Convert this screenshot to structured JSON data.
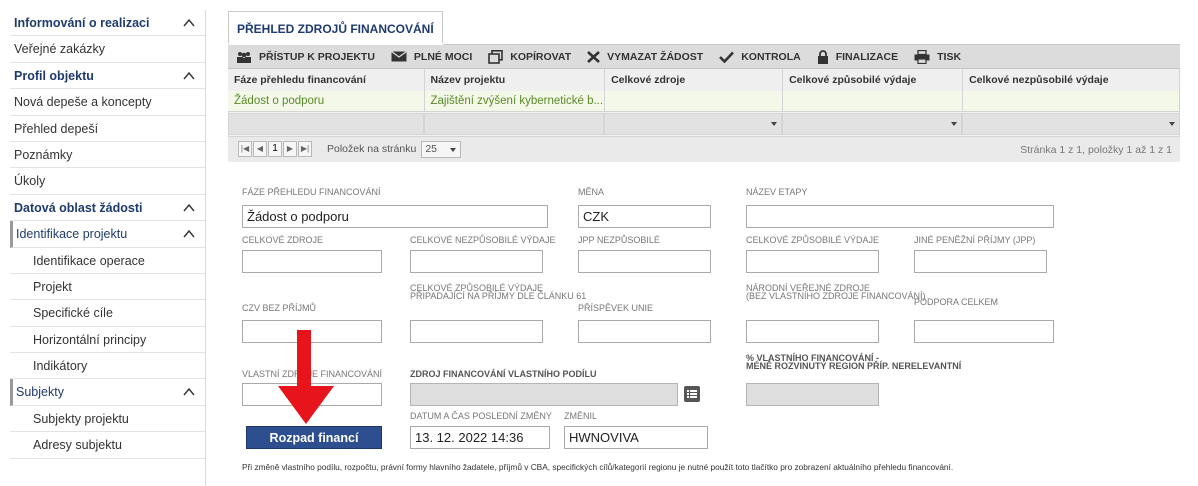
{
  "sidebar": {
    "items": [
      {
        "label": "Informování o realizaci",
        "type": "head"
      },
      {
        "label": "Veřejné zakázky",
        "type": "item"
      },
      {
        "label": "Profil objektu",
        "type": "head"
      },
      {
        "label": "Nová depeše a koncepty",
        "type": "item"
      },
      {
        "label": "Přehled depeší",
        "type": "item"
      },
      {
        "label": "Poznámky",
        "type": "item"
      },
      {
        "label": "Úkoly",
        "type": "item"
      },
      {
        "label": "Datová oblast žádosti",
        "type": "head"
      },
      {
        "label": "Identifikace projektu",
        "type": "group"
      },
      {
        "label": "Identifikace operace",
        "type": "sub"
      },
      {
        "label": "Projekt",
        "type": "sub"
      },
      {
        "label": "Specifické cíle",
        "type": "sub"
      },
      {
        "label": "Horizontální principy",
        "type": "sub"
      },
      {
        "label": "Indikátory",
        "type": "sub"
      },
      {
        "label": "Subjekty",
        "type": "group"
      },
      {
        "label": "Subjekty projektu",
        "type": "sub"
      },
      {
        "label": "Adresy subjektu",
        "type": "sub"
      }
    ]
  },
  "tab": {
    "label": "PŘEHLED ZDROJŮ FINANCOVÁNÍ"
  },
  "toolbar": {
    "access": "PŘÍSTUP K PROJEKTU",
    "powers": "PLNÉ MOCI",
    "copy": "KOPÍROVAT",
    "delete": "VYMAZAT ŽÁDOST",
    "check": "KONTROLA",
    "finalize": "FINALIZACE",
    "print": "TISK"
  },
  "grid": {
    "headers": [
      "Fáze přehledu financování",
      "Název projektu",
      "Celkové zdroje",
      "Celkové způsobilé výdaje",
      "Celkové nezpůsobilé výdaje"
    ],
    "row": [
      "Žádost o podporu",
      "Zajištění zvýšení kybernetické b...",
      "",
      "",
      ""
    ]
  },
  "pager": {
    "current": "1",
    "per_page_label": "Položek na stránku",
    "per_page": "25",
    "summary": "Stránka 1 z 1, položky 1 až 1 z 1"
  },
  "form": {
    "faze_label": "FÁZE PŘEHLEDU FINANCOVÁNÍ",
    "faze_value": "Žádost o podporu",
    "mena_label": "MĚNA",
    "mena_value": "CZK",
    "etapa_label": "NÁZEV ETAPY",
    "zdroje_label": "CELKOVÉ ZDROJE",
    "nezpusobile_label": "CELKOVÉ NEZPŮSOBILÉ VÝDAJE",
    "jpp_nezp_label": "JPP NEZPŮSOBILÉ",
    "zpusobile_label": "CELKOVÉ ZPŮSOBILÉ VÝDAJE",
    "jine_label": "JINÉ PENĚŽNÍ PŘÍJMY (JPP)",
    "czv_label": "CZV BEZ PŘÍJMŮ",
    "pripadajici_label_1": "CELKOVÉ ZPŮSOBILÉ VÝDAJE",
    "pripadajici_label_2": "PŘIPADAJÍCÍ NA PŘÍJMY DLE ČLÁNKU 61",
    "prispevek_label": "PŘÍSPĚVEK UNIE",
    "narodni_label_1": "NÁRODNÍ VEŘEJNÉ ZDROJE",
    "narodni_label_2": "(BEZ VLASTNÍHO ZDROJE FINANCOVÁNÍ)",
    "podpora_label": "PODPORA CELKEM",
    "vlastni_label": "VLASTNÍ ZDROJE FINANCOVÁNÍ",
    "zdroj_vlastni_label": "ZDROJ FINANCOVÁNÍ VLASTNÍHO PODÍLU",
    "procento_label_1": "% VLASTNÍHO FINANCOVÁNÍ -",
    "procento_label_2": "MÉNĚ ROZVINUTÝ REGION PŘÍP. NERELEVANTNÍ",
    "datum_label": "DATUM A ČAS POSLEDNÍ ZMĚNY",
    "datum_value": "13. 12. 2022 14:36",
    "zmenil_label": "ZMĚNIL",
    "zmenil_value": "HWNOVIVA",
    "button": "Rozpad financí",
    "note": "Při změně vlastního podílu, rozpočtu, právní formy hlavního žadatele, příjmů v CBA, specifických cílů/kategorií regionu je nutné použít toto tlačítko pro zobrazení aktuálního přehledu financování."
  },
  "colors": {
    "accent": "#2e4f8f",
    "arrow": "#e8141b",
    "link_green": "#5a8a2a"
  }
}
